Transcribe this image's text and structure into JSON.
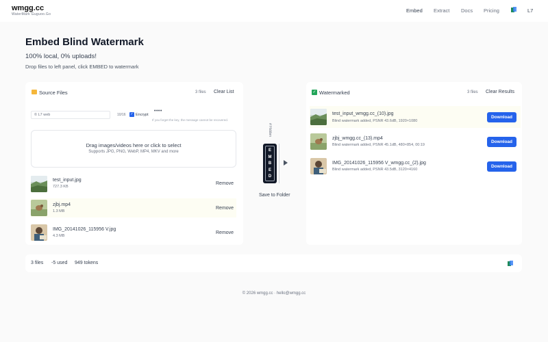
{
  "app": {
    "brand": "wmgg.cc",
    "brand_sub": "WaterMark Guguoo.Go"
  },
  "nav": {
    "items": [
      "Embed",
      "Extract",
      "Docs",
      "Pricing"
    ],
    "active": "Embed",
    "user": "L7"
  },
  "hero": {
    "title": "Embed Blind Watermark",
    "subtitle": "100% local, 0% uploads!",
    "instructions": "Drop files to left panel, click EMBED to watermark"
  },
  "source": {
    "title": "Source Files",
    "count": "3 files",
    "clear_label": "Clear List",
    "watermark_value": "© L7 web",
    "counter": "10/16",
    "encrypt_label": "Encrypt",
    "encrypt_checked": true,
    "password_mask": "••••",
    "hint": "If you forget the key, the message cannot be recovered.",
    "dropzone_title": "Drag images/videos here or click to select",
    "dropzone_sub": "Supports JPG, PNG, WebP, MP4, MKV and more",
    "remove_label": "Remove",
    "files": [
      {
        "name": "test_input.jpg",
        "size": "727.3 KB",
        "thumb": "landscape-thumb"
      },
      {
        "name": "zjbj.mp4",
        "size": "1.3 MB",
        "thumb": "bird-thumb"
      },
      {
        "name": "IMG_20141026_115956 V.jpg",
        "size": "4.3 MB",
        "thumb": "person-thumb"
      }
    ]
  },
  "middle": {
    "flag_label": "# Hidden",
    "embed_label": "EMBED",
    "save_label": "Save to Folder"
  },
  "result": {
    "title": "Watermarked",
    "count": "3 files",
    "clear_label": "Clear Results",
    "download_label": "Download",
    "files": [
      {
        "name": "test_input_wmgg.cc_(10).jpg",
        "info": "Blind watermark added, PSNR 43.6dB, 1920×1080",
        "thumb": "landscape-thumb"
      },
      {
        "name": "zjbj_wmgg.cc_(13).mp4",
        "info": "Blind watermark added, PSNR 45.1dB, 480×854, 00:19",
        "thumb": "bird-thumb"
      },
      {
        "name": "IMG_20141026_115956 V_wmgg.cc_(2).jpg",
        "info": "Blind watermark added, PSNR 43.5dB, 3120×4160",
        "thumb": "person-thumb"
      }
    ]
  },
  "stats": {
    "files": "3 files",
    "used": "-5 used",
    "tokens": "949 tokens"
  },
  "footer": {
    "copyright": "© 2026 wmgg.cc · hello@wmgg.cc"
  },
  "colors": {
    "accent": "#2563eb",
    "embed_button": "#111827",
    "folder": "#f5b73b",
    "success": "#22a559"
  }
}
